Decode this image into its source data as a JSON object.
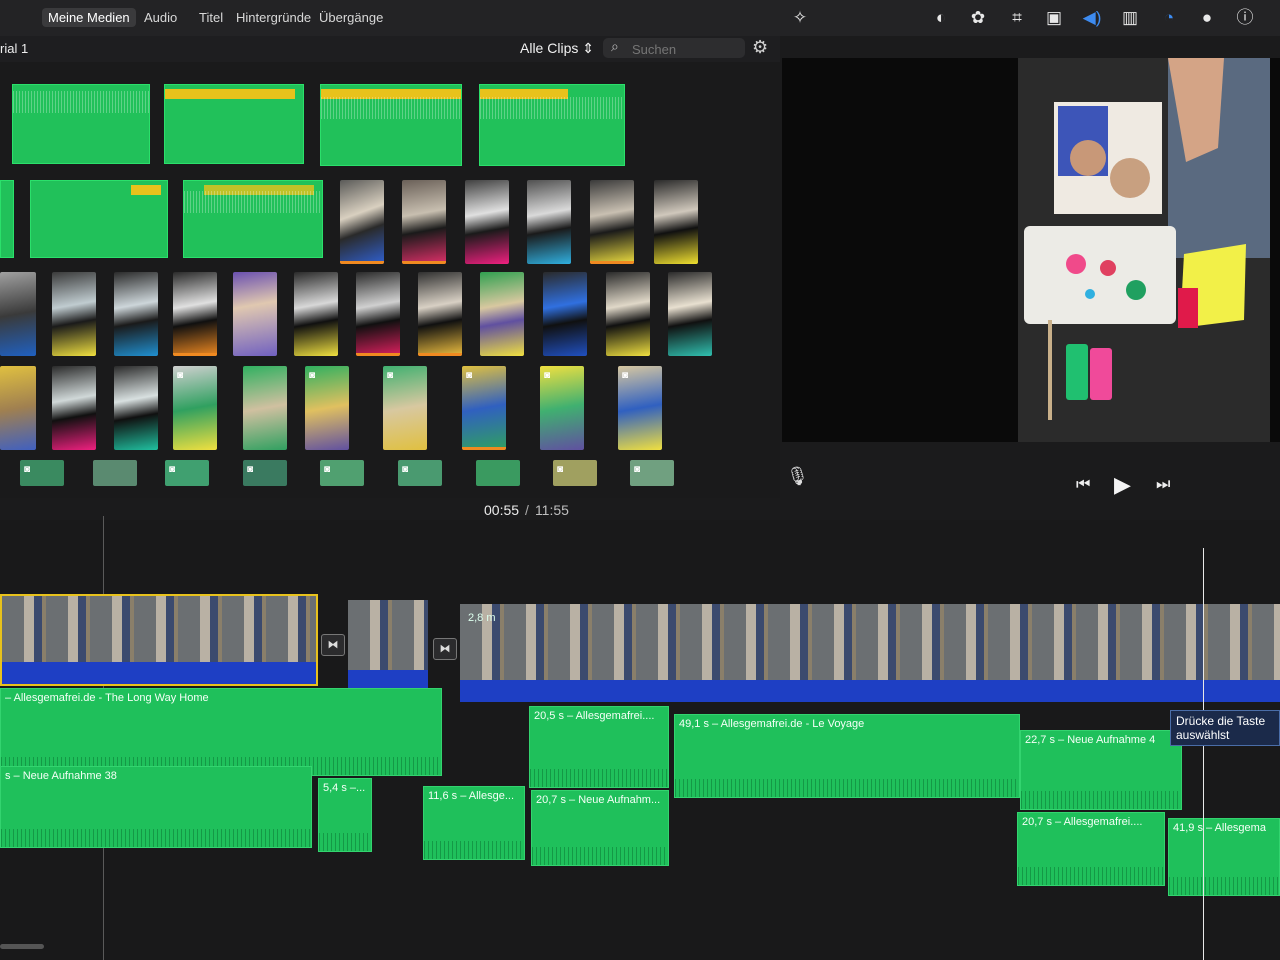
{
  "tabs": [
    "Meine Medien",
    "Audio",
    "Titel",
    "Hintergründe",
    "Übergänge"
  ],
  "active_tab": "Meine Medien",
  "toolbar_icons": [
    "magic-wand-icon",
    "color-balance-icon",
    "color-palette-icon",
    "crop-icon",
    "stabilization-icon",
    "volume-icon",
    "equalizer-icon",
    "speed-icon",
    "noise-reduction-icon",
    "info-icon"
  ],
  "library": {
    "project_title": "rial 1",
    "filter_label": "Alle Clips ⇕",
    "search_placeholder": "Suchen"
  },
  "viewer": {
    "timecode_current": "00:55",
    "timecode_separator": "/",
    "timecode_total": "11:55"
  },
  "timeline": {
    "clip_duration_label": "2,8 m",
    "tooltip_line1": "Drücke die Taste",
    "tooltip_line2": "auswählst",
    "audio_clips": [
      {
        "label": "– Allesgemafrei.de - The Long Way Home"
      },
      {
        "label": "s – Neue Aufnahme 38"
      },
      {
        "label": "5,4 s –..."
      },
      {
        "label": "11,6 s – Allesge..."
      },
      {
        "label": "20,5 s – Allesgemafrei...."
      },
      {
        "label": "20,7 s – Neue Aufnahm..."
      },
      {
        "label": "49,1 s – Allesgemafrei.de - Le Voyage"
      },
      {
        "label": "22,7 s – Neue Aufnahme 4"
      },
      {
        "label": "20,7 s – Allesgemafrei...."
      },
      {
        "label": "41,9 s – Allesgema"
      }
    ]
  },
  "colors": {
    "audio_green": "#1fc05b",
    "video_blue": "#1e3fc4",
    "selection_yellow": "#e8c21c",
    "orange_marker": "#f08a21"
  }
}
